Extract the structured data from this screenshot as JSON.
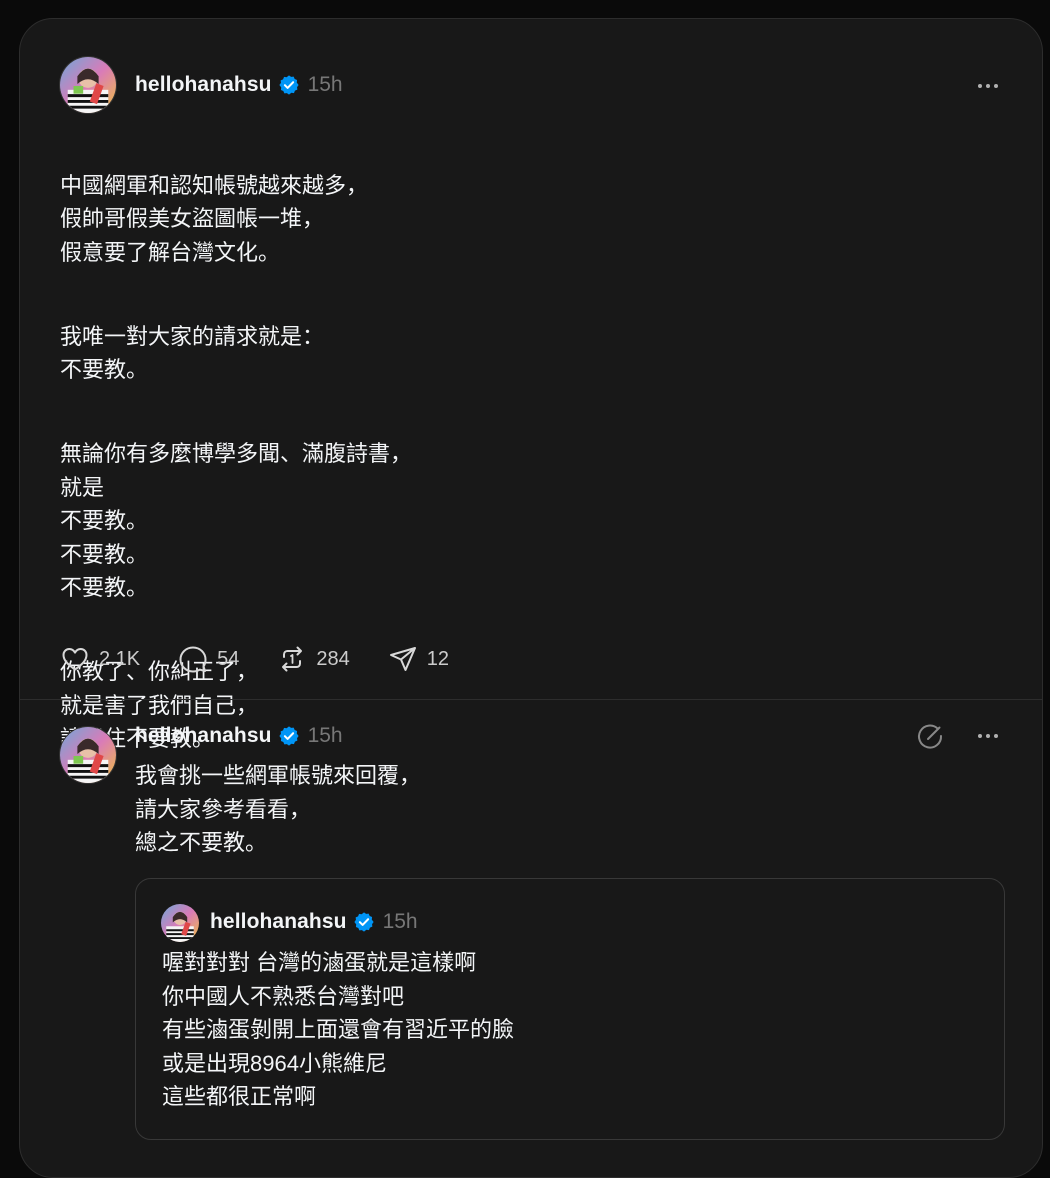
{
  "post": {
    "username": "hellohanahsu",
    "time": "15h",
    "paragraphs": [
      "中國網軍和認知帳號越來越多，\n假帥哥假美女盜圖帳一堆，\n假意要了解台灣文化。",
      "我唯一對大家的請求就是：\n不要教。",
      "無論你有多麼博學多聞、滿腹詩書，\n就是\n不要教。\n不要教。\n不要教。",
      "你教了、你糾正了，\n就是害了我們自己，\n請忍住不要教。"
    ],
    "actions": {
      "likes": "2.1K",
      "replies": "54",
      "reposts": "284",
      "shares": "12"
    }
  },
  "reply": {
    "username": "hellohanahsu",
    "time": "15h",
    "text": "我會挑一些網軍帳號來回覆，\n請大家參考看看，\n總之不要教。"
  },
  "quoted": {
    "username": "hellohanahsu",
    "time": "15h",
    "text": "喔對對對 台灣的滷蛋就是這樣啊\n你中國人不熟悉台灣對吧\n有些滷蛋剝開上面還會有習近平的臉\n或是出現8964小熊維尼\n這些都很正常啊"
  },
  "colors": {
    "background": "#181818",
    "verified": "#0095f6",
    "muted": "#777777"
  },
  "icons": [
    "verified-badge-icon",
    "more-icon",
    "heart-icon",
    "comment-icon",
    "repost-icon",
    "share-icon",
    "edit-icon"
  ]
}
